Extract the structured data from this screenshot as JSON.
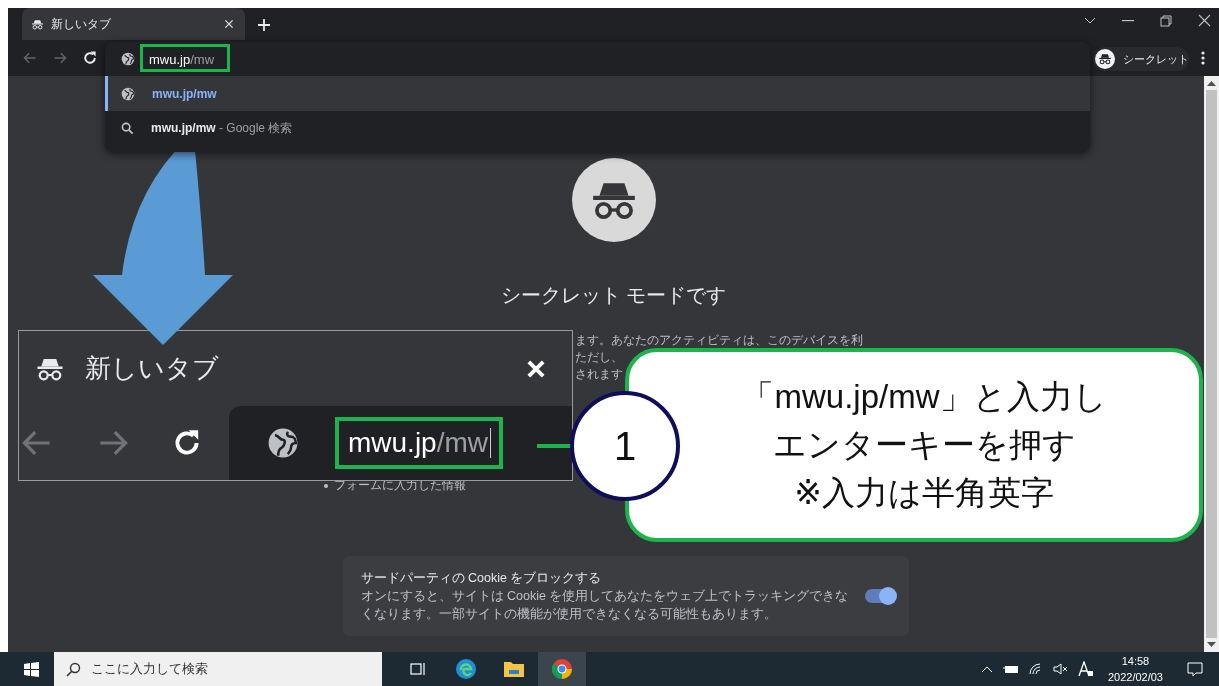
{
  "browser": {
    "tab": {
      "title": "新しいタブ"
    },
    "address": {
      "typed": "mwu.jp",
      "suggested": "/mw"
    },
    "suggestions": [
      {
        "kind": "url",
        "text": "mwu.jp/mw",
        "selected": true
      },
      {
        "kind": "search",
        "text": "mwu.jp/mw",
        "suffix": " - Google 検索",
        "selected": false
      }
    ],
    "profile": "シークレット"
  },
  "page": {
    "title": "シークレット モードです",
    "intro_lines": [
      "ます。あなたのアクティビティは、このデバイスを利",
      "ただし、",
      "されます"
    ],
    "list_item": "フォームに入力した情報",
    "cookie": {
      "title": "サードパーティの Cookie をブロックする",
      "description": "オンにすると、サイトは Cookie を使用してあなたをウェブ上でトラッキングできなくなります。一部サイトの機能が使用できなくなる可能性もあります。",
      "on": true
    }
  },
  "inset": {
    "tab_title": "新しいタブ",
    "address": {
      "typed": "mwu.jp",
      "suggested": "/mw"
    }
  },
  "callout": {
    "step": "1",
    "lines": [
      "「mwu.jp/mw」と入力し",
      "エンターキーを押す",
      "※入力は半角英字"
    ]
  },
  "taskbar": {
    "search_placeholder": "ここに入力して検索",
    "time": "14:58",
    "date": "2022/02/03"
  }
}
